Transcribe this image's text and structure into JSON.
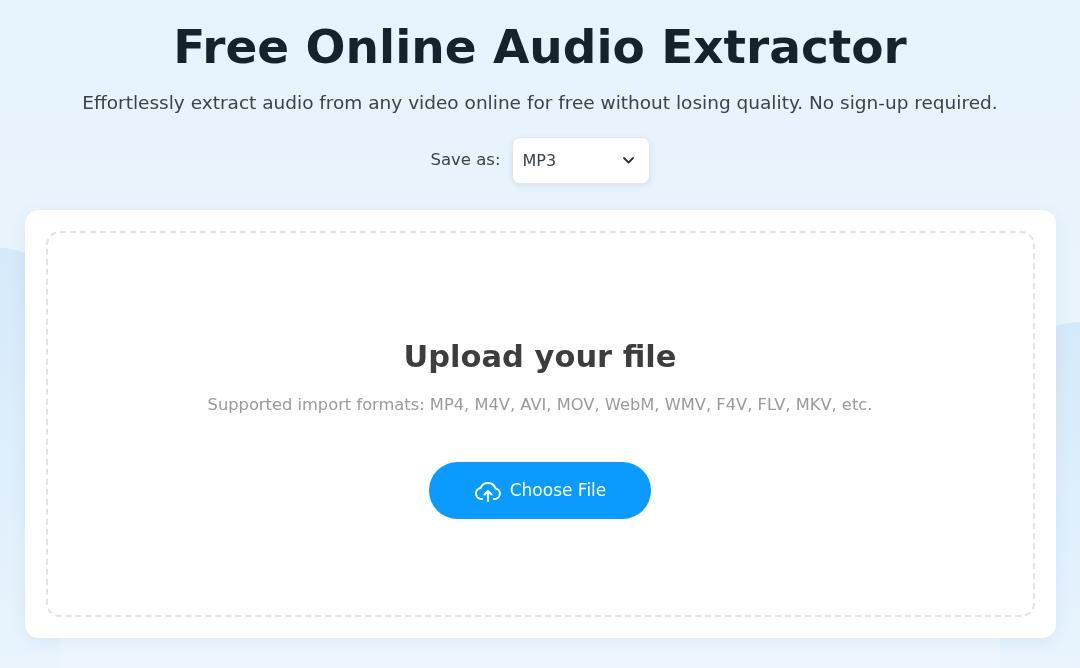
{
  "header": {
    "title": "Free Online Audio Extractor",
    "subtitle": "Effortlessly extract audio from any video online for free without losing quality. No sign-up required."
  },
  "format_picker": {
    "label": "Save as:",
    "value": "MP3"
  },
  "upload_panel": {
    "heading": "Upload your file",
    "supported_formats": "Supported import formats: MP4, M4V, AVI, MOV, WebM, WMV, F4V, FLV, MKV, etc.",
    "button": {
      "label": "Choose File"
    }
  }
}
